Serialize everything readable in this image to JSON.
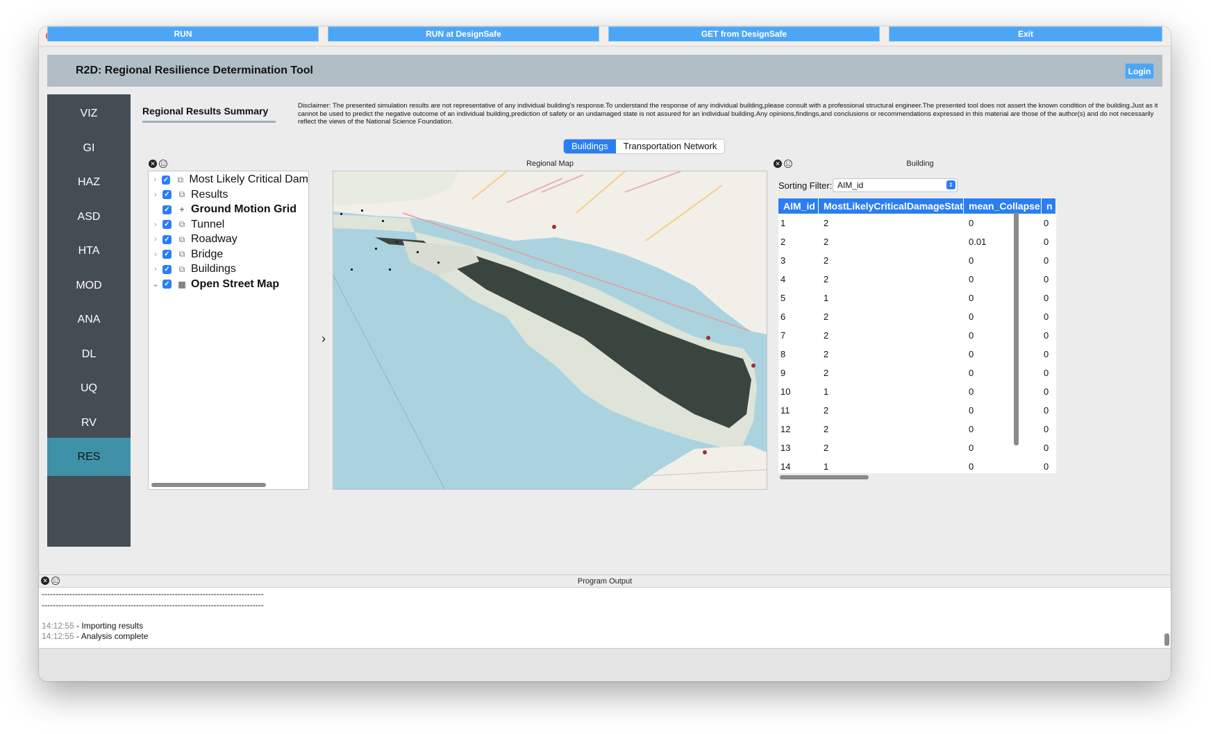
{
  "window": {
    "title_bar_buttons": [
      "close",
      "minimize",
      "zoom"
    ]
  },
  "header": {
    "title": "R2D: Regional Resilience Determination Tool",
    "login_label": "Login"
  },
  "sidebar": {
    "items": [
      "VIZ",
      "GI",
      "HAZ",
      "ASD",
      "HTA",
      "MOD",
      "ANA",
      "DL",
      "UQ",
      "RV",
      "RES"
    ],
    "active": "RES"
  },
  "summary": {
    "title": "Regional Results Summary",
    "disclaimer": "Disclaimer: The presented simulation results are not representative of any individual building's response.To understand the response of any individual building,please consult with a professional structural engineer.The presented tool does not assert the known condition of the building.Just as it cannot be used to predict the negative outcome of an individual building,prediction of safety or an undamaged state is not assured for an individual building.Any opinions,findings,and conclusions or recommendations expressed in this material are those of the author(s) and do not necessarily reflect the views of the National Science Foundation."
  },
  "tabs": [
    {
      "label": "Buildings",
      "active": true
    },
    {
      "label": "Transportation Network",
      "active": false
    }
  ],
  "layers": [
    {
      "label": "Most Likely Critical Dam",
      "icon": "layers-icon",
      "bold": false,
      "expanded": false
    },
    {
      "label": "Results",
      "icon": "layers-icon",
      "bold": false,
      "expanded": false
    },
    {
      "label": "Ground Motion Grid",
      "icon": "point-icon",
      "bold": true,
      "expanded": null
    },
    {
      "label": "Tunnel",
      "icon": "layers-icon",
      "bold": false,
      "expanded": false
    },
    {
      "label": "Roadway",
      "icon": "layers-icon",
      "bold": false,
      "expanded": false
    },
    {
      "label": "Bridge",
      "icon": "layers-icon",
      "bold": false,
      "expanded": false
    },
    {
      "label": "Buildings",
      "icon": "layers-icon",
      "bold": false,
      "expanded": false
    },
    {
      "label": "Open Street Map",
      "icon": "raster-icon",
      "bold": true,
      "expanded": true
    }
  ],
  "map_panel": {
    "title": "Regional Map"
  },
  "building_panel": {
    "title": "Building",
    "sort_label": "Sorting Filter:",
    "sort_value": "AIM_id",
    "columns": [
      "AIM_id",
      "MostLikelyCriticalDamageState",
      "mean_Collapse",
      "n"
    ],
    "rows": [
      [
        "1",
        "2",
        "0",
        "0"
      ],
      [
        "2",
        "2",
        "0.01",
        "0"
      ],
      [
        "3",
        "2",
        "0",
        "0"
      ],
      [
        "4",
        "2",
        "0",
        "0"
      ],
      [
        "5",
        "1",
        "0",
        "0"
      ],
      [
        "6",
        "2",
        "0",
        "0"
      ],
      [
        "7",
        "2",
        "0",
        "0"
      ],
      [
        "8",
        "2",
        "0",
        "0"
      ],
      [
        "9",
        "2",
        "0",
        "0"
      ],
      [
        "10",
        "1",
        "0",
        "0"
      ],
      [
        "11",
        "2",
        "0",
        "0"
      ],
      [
        "12",
        "2",
        "0",
        "0"
      ],
      [
        "13",
        "2",
        "0",
        "0"
      ],
      [
        "14",
        "1",
        "0",
        "0"
      ]
    ]
  },
  "buttons": {
    "run": "RUN",
    "run_ds": "RUN at DesignSafe",
    "get_ds": "GET from DesignSafe",
    "exit": "Exit"
  },
  "output": {
    "title": "Program Output",
    "separator": "--------------------------------------------------------------------------------",
    "lines": [
      {
        "time": "14:12:55",
        "text": " - Importing results"
      },
      {
        "time": "14:12:55",
        "text": " - Analysis complete"
      }
    ]
  },
  "colors": {
    "accent": "#2a7ef2",
    "button": "#4da6f5",
    "sidebar": "#444c54",
    "sidebar_active": "#3f91a8",
    "header": "#b2bec5",
    "water": "#aad3df"
  }
}
